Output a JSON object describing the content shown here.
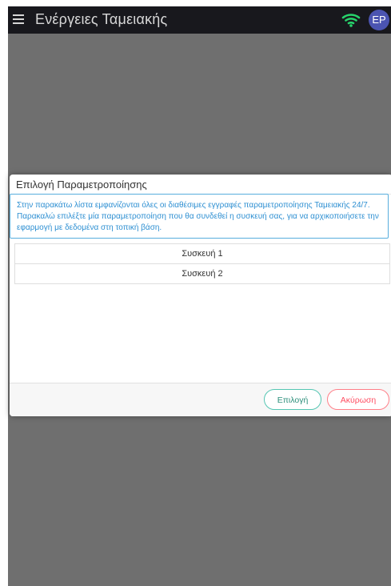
{
  "app": {
    "title": "Ενέργειες Ταμειακής",
    "avatar_initials": "ΕΡ",
    "colors": {
      "topbar_bg": "#18181d",
      "overlay": "#6f6f6f",
      "accent_blue": "#2d8fd2",
      "select_green": "#2c8f7b",
      "cancel_red": "#ff4f63"
    }
  },
  "modal": {
    "title": "Επιλογή Παραμετροποίησης",
    "info": "Στην παρακάτω λίστα εμφανίζονται όλες οι διαθέσιμες εγγραφές παραμετροποίησης Ταμειακής 24/7. Παρακαλώ επιλέξτε μία παραμετροποίηση που θα συνδεθεί η συσκευή σας, για να αρχικοποιήσετε την εφαρμογή με δεδομένα στη τοπική βάση.",
    "items": [
      "Συσκευή 1",
      "Συσκευή 2"
    ],
    "buttons": {
      "select": "Επιλογή",
      "cancel": "Ακύρωση"
    }
  }
}
